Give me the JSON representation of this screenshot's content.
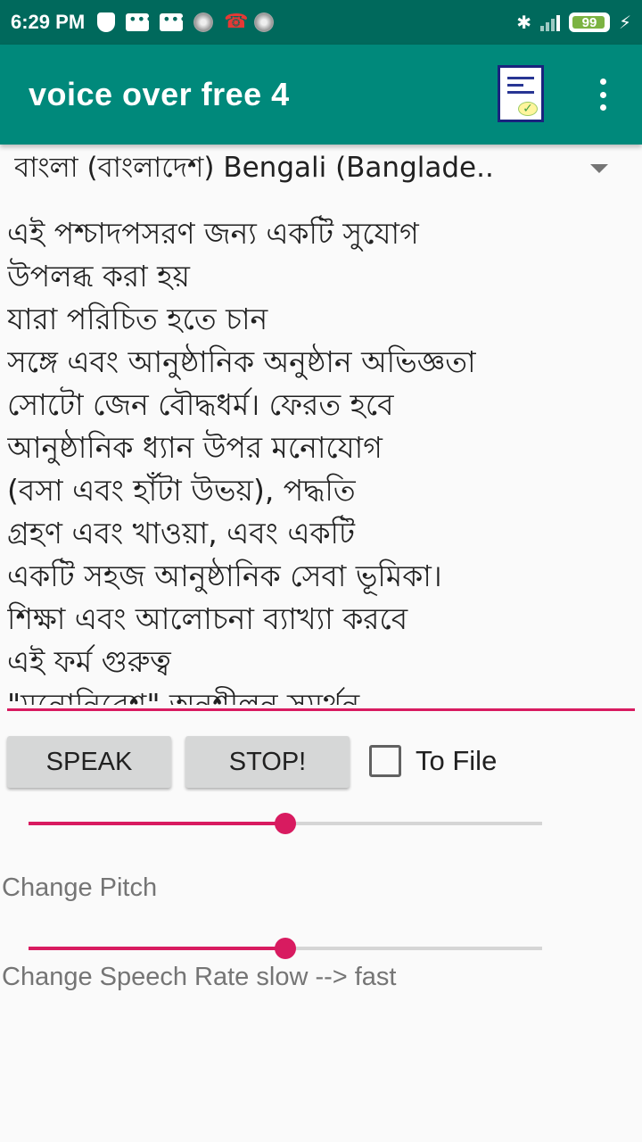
{
  "status_bar": {
    "time": "6:29 PM",
    "battery": "99",
    "icons": [
      "shield-icon",
      "message-icon",
      "message-icon",
      "circle-dot-icon",
      "missed-call-icon",
      "circle-dot-icon",
      "bluetooth-icon",
      "signal-icon",
      "battery-icon",
      "charging-icon"
    ]
  },
  "app_bar": {
    "title": "voice over free 4",
    "actions": [
      "document-check-icon",
      "overflow-menu-icon"
    ]
  },
  "language_spinner": {
    "selected": "বাংলা (বাংলাদেশ) Bengali (Banglade.."
  },
  "editor": {
    "lines": [
      "এই পশ্চাদপসরণ জন্য একটি সুযোগ",
      "উপলব্ধ করা হয়",
      "যারা পরিচিত হতে চান",
      "সঙ্গে এবং আনুষ্ঠানিক অনুষ্ঠান অভিজ্ঞতা",
      "সোটো জেন বৌদ্ধধর্ম। ফেরত হবে",
      "আনুষ্ঠানিক ধ্যান উপর মনোযোগ",
      "(বসা এবং হাঁটা উভয়), পদ্ধতি",
      "গ্রহণ এবং খাওয়া, এবং একটি",
      "একটি সহজ আনুষ্ঠানিক সেবা ভূমিকা।",
      "শিক্ষা এবং আলোচনা ব্যাখ্যা করবে",
      "এই ফর্ম গুরুত্ব",
      "\"মনোনিবেশ\" অনুশীলন সমর্থন"
    ]
  },
  "controls": {
    "speak_label": "SPEAK",
    "stop_label": "STOP!",
    "to_file_label": "To File",
    "to_file_checked": false
  },
  "pitch": {
    "label": "Change Pitch",
    "value_fraction": 0.5
  },
  "rate": {
    "label": "Change Speech Rate slow --> fast",
    "value_fraction": 0.5
  },
  "colors": {
    "status_bar": "#00695c",
    "app_bar": "#00897b",
    "accent": "#d81b60"
  }
}
